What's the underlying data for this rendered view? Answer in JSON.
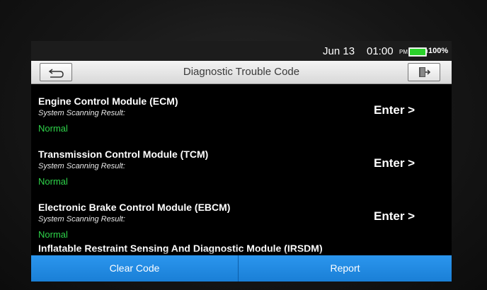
{
  "status": {
    "date": "Jun 13",
    "time": "01:00",
    "ampm": "PM",
    "battery_percent": "100%",
    "battery_level": 1.0,
    "battery_color": "#2bd12b"
  },
  "titlebar": {
    "title": "Diagnostic Trouble Code",
    "back_icon": "back-arrow-icon",
    "exit_icon": "exit-door-icon"
  },
  "modules": [
    {
      "name": "Engine Control Module (ECM)",
      "subtitle": "System Scanning Result:",
      "status": "Normal",
      "action": "Enter >"
    },
    {
      "name": "Transmission Control Module (TCM)",
      "subtitle": "System Scanning Result:",
      "status": "Normal",
      "action": "Enter >"
    },
    {
      "name": "Electronic Brake Control Module (EBCM)",
      "subtitle": "System Scanning Result:",
      "status": "Normal",
      "action": "Enter >"
    }
  ],
  "partial_module": {
    "name": "Inflatable Restraint Sensing And Diagnostic Module (IRSDM)"
  },
  "footer": {
    "clear_label": "Clear Code",
    "report_label": "Report",
    "accent_color": "#1d86e0"
  },
  "colors": {
    "status_normal": "#2ed44a",
    "background": "#000000"
  }
}
